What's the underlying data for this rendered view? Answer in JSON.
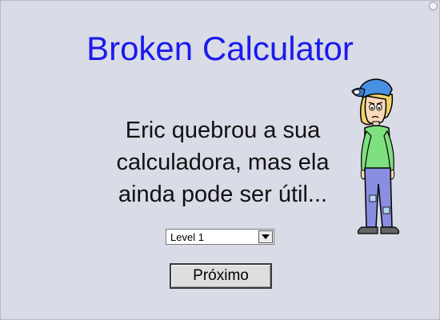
{
  "title": "Broken Calculator",
  "message_lines": [
    "Eric quebrou a sua",
    "calculadora, mas ela",
    "ainda pode ser útil..."
  ],
  "level_select": {
    "selected": "Level 1",
    "arrow_icon": "triangle-down"
  },
  "next_button": {
    "label": "Próximo"
  },
  "character": {
    "icon": "sad-boy-illustration",
    "cap_color": "#4a90e2",
    "shirt_color": "#7fe07f",
    "pants_color": "#8a8ee0"
  },
  "colors": {
    "background": "#d9dbe6",
    "title": "#1a1aee",
    "text": "#111111"
  }
}
